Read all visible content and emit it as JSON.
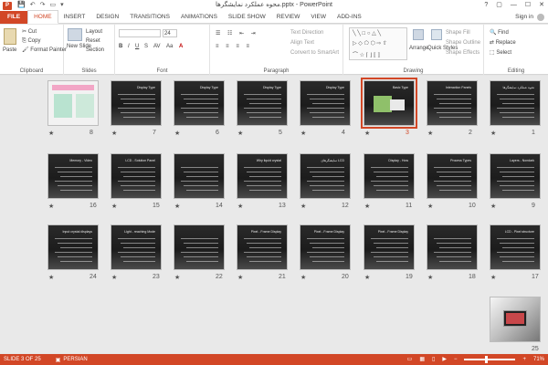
{
  "titlebar": {
    "title": "محوه عملکرد نمایشگرها.pptx - PowerPoint",
    "app_icon": "P",
    "qat_save": "💾",
    "qat_undo": "↶",
    "qat_redo": "↷",
    "qat_present": "▭",
    "qat_more": "▾",
    "help": "?",
    "restore_ribbon": "▢",
    "minimize": "—",
    "maximize": "☐",
    "close": "✕"
  },
  "tabs": [
    "FILE",
    "HOME",
    "INSERT",
    "DESIGN",
    "TRANSITIONS",
    "ANIMATIONS",
    "SLIDE SHOW",
    "REVIEW",
    "VIEW",
    "ADD-INS"
  ],
  "active_tab": "HOME",
  "signin": "Sign in",
  "ribbon": {
    "clipboard": {
      "label": "Clipboard",
      "paste": "Paste",
      "cut": "Cut",
      "copy": "Copy",
      "format_painter": "Format Painter"
    },
    "slides": {
      "label": "Slides",
      "new_slide": "New Slide",
      "layout": "Layout",
      "reset": "Reset",
      "section": "Section"
    },
    "font": {
      "label": "Font",
      "size": "24",
      "bold": "B",
      "italic": "I",
      "underline": "U",
      "strike": "S",
      "spacing": "AV",
      "case": "Aa",
      "color": "A"
    },
    "paragraph": {
      "label": "Paragraph",
      "text_direction": "Text Direction",
      "align_text": "Align Text",
      "convert_smartart": "Convert to SmartArt"
    },
    "drawing": {
      "label": "Drawing",
      "arrange": "Arrange",
      "quick_styles": "Quick Styles",
      "shape_fill": "Shape Fill",
      "shape_outline": "Shape Outline",
      "shape_effects": "Shape Effects"
    },
    "editing": {
      "label": "Editing",
      "find": "Find",
      "replace": "Replace",
      "select": "Select"
    }
  },
  "slides": [
    {
      "num": "1",
      "title": "نحوه عملکرد نمایشگرها",
      "kind": "dark"
    },
    {
      "num": "2",
      "title": "Interaction Panels",
      "kind": "dark"
    },
    {
      "num": "3",
      "title": "Basic Type",
      "kind": "selected"
    },
    {
      "num": "4",
      "title": "Display Type",
      "kind": "dark"
    },
    {
      "num": "5",
      "title": "Display Type",
      "kind": "dark"
    },
    {
      "num": "6",
      "title": "Display Type",
      "kind": "dark"
    },
    {
      "num": "7",
      "title": "Display Type",
      "kind": "dark"
    },
    {
      "num": "8",
      "title": "",
      "kind": "light"
    },
    {
      "num": "9",
      "title": "Layers - Nondark",
      "kind": "dark"
    },
    {
      "num": "10",
      "title": "Process Types",
      "kind": "dark"
    },
    {
      "num": "11",
      "title": "Display - How",
      "kind": "dark"
    },
    {
      "num": "12",
      "title": "نمایشگرهای LCD",
      "kind": "dark"
    },
    {
      "num": "13",
      "title": "Why liquid crystal",
      "kind": "dark"
    },
    {
      "num": "14",
      "title": "",
      "kind": "dark"
    },
    {
      "num": "15",
      "title": "LCD - Solution Panel",
      "kind": "dark"
    },
    {
      "num": "16",
      "title": "Memory - Video",
      "kind": "dark"
    },
    {
      "num": "17",
      "title": "LCD - Pixel structure",
      "kind": "dark"
    },
    {
      "num": "18",
      "title": "",
      "kind": "dark"
    },
    {
      "num": "19",
      "title": "Pixel - Frame Display",
      "kind": "dark"
    },
    {
      "num": "20",
      "title": "Pixel - Frame Display",
      "kind": "dark"
    },
    {
      "num": "21",
      "title": "Pixel - Frame Display",
      "kind": "dark"
    },
    {
      "num": "22",
      "title": "",
      "kind": "dark"
    },
    {
      "num": "23",
      "title": "Light - reaching Mode",
      "kind": "dark"
    },
    {
      "num": "24",
      "title": "Input crystal displays",
      "kind": "dark"
    },
    {
      "num": "25",
      "title": "",
      "kind": "photo"
    }
  ],
  "star": "★",
  "status": {
    "slide_info": "SLIDE 3 OF 25",
    "language": "PERSIAN",
    "zoom_minus": "−",
    "zoom_plus": "+",
    "zoom": "71%"
  }
}
